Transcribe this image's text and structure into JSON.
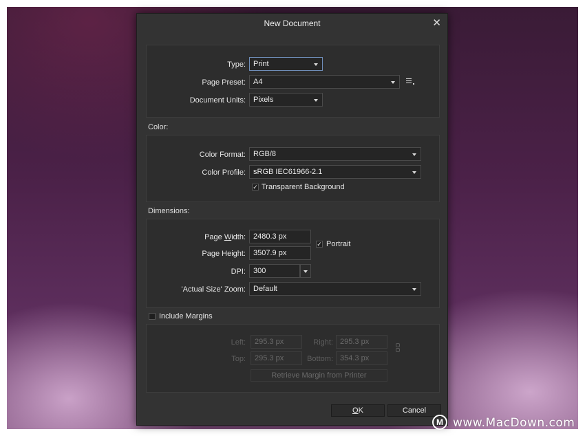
{
  "dialog": {
    "title": "New Document",
    "close_glyph": "✕"
  },
  "document": {
    "type_label": "Type:",
    "type_value": "Print",
    "preset_label": "Page Preset:",
    "preset_value": "A4",
    "units_label": "Document Units:",
    "units_value": "Pixels"
  },
  "color": {
    "section_label": "Color:",
    "format_label": "Color Format:",
    "format_value": "RGB/8",
    "profile_label": "Color Profile:",
    "profile_value": "sRGB IEC61966-2.1",
    "transparent_label": "Transparent Background",
    "transparent_checked": true
  },
  "dimensions": {
    "section_label": "Dimensions:",
    "width_label_pre": "Page ",
    "width_label_u": "W",
    "width_label_post": "idth:",
    "width_value": "2480.3 px",
    "height_label": "Page Height:",
    "height_value": "3507.9 px",
    "portrait_label": "Portrait",
    "portrait_checked": true,
    "dpi_label": "DPI:",
    "dpi_value": "300",
    "zoom_label": "'Actual Size' Zoom:",
    "zoom_value": "Default"
  },
  "margins": {
    "include_label": "Include Margins",
    "include_checked": false,
    "left_label": "Left:",
    "left_value": "295.3 px",
    "right_label": "Right:",
    "right_value": "295.3 px",
    "top_label": "Top:",
    "top_value": "295.3 px",
    "bottom_label": "Bottom:",
    "bottom_value": "354.3 px",
    "retrieve_label": "Retrieve Margin from Printer"
  },
  "buttons": {
    "ok_u": "O",
    "ok_rest": "K",
    "cancel_label": "Cancel"
  },
  "watermark": {
    "logo": "M",
    "text": "www.MacDown.com"
  },
  "icons": {
    "close": "close-icon",
    "dropdown": "chevron-down-icon",
    "preset_menu": "list-menu-icon",
    "chain_link": "chain-link-icon",
    "checkbox": "checkmark-icon"
  },
  "colors": {
    "dialog_bg": "#333333",
    "panel_bg": "#2d2d2d",
    "field_bg": "#252525",
    "focus_border": "#6f8db8"
  }
}
